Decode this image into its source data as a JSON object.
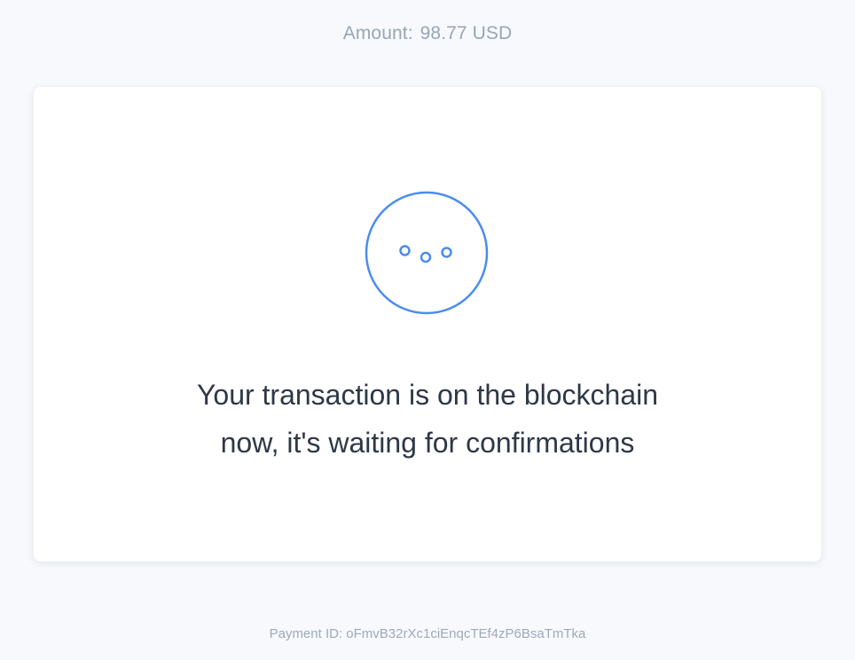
{
  "header": {
    "amount_label": "Amount:",
    "amount_value": "98.77 USD"
  },
  "status": {
    "icon": "waiting-dots-icon",
    "message_line1": "Your transaction is on the blockchain",
    "message_line2": "now, it's waiting for confirmations"
  },
  "footer": {
    "payment_id_label": "Payment ID:",
    "payment_id_value": "oFmvB32rXc1ciEnqcTEf4zP6BsaTmTka"
  },
  "colors": {
    "background": "#f7f9fc",
    "card": "#ffffff",
    "accent": "#4a8cf0",
    "muted_text": "#9aa5b4",
    "primary_text": "#2f3747"
  }
}
